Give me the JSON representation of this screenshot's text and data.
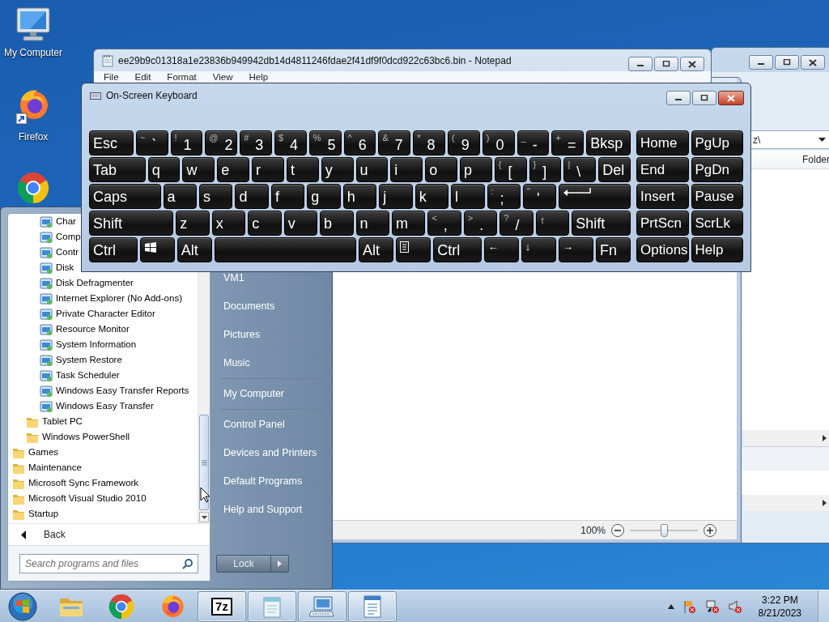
{
  "desktop_icons": [
    {
      "kind": "computer",
      "label": "My Computer"
    },
    {
      "kind": "firefox",
      "label": "Firefox"
    },
    {
      "kind": "chrome"
    }
  ],
  "explorer_window": {
    "address": "z\\",
    "column_header": "Folder"
  },
  "document_window": {
    "zoom": "100%",
    "zoom_slider": {
      "level": 0.5
    }
  },
  "notepad_window": {
    "title": "ee29b9c01318a1e23836b949942db14d4811246fdae2f41df9f0dcd922c63bc6.bin - Notepad",
    "menu": [
      "File",
      "Edit",
      "Format",
      "View",
      "Help"
    ]
  },
  "start_menu": {
    "programs": [
      {
        "kind": "group",
        "children": [
          {
            "kind": "group",
            "children": [
              {
                "kind": "program",
                "label": "Char"
              },
              {
                "kind": "program",
                "label": "Comp"
              },
              {
                "kind": "program",
                "label": "Contr"
              },
              {
                "kind": "program",
                "label": "Disk"
              },
              {
                "kind": "program",
                "label": "Disk Defragmenter"
              },
              {
                "kind": "program",
                "label": "Internet Explorer (No Add-ons)"
              },
              {
                "kind": "program",
                "label": "Private Character Editor"
              },
              {
                "kind": "program",
                "label": "Resource Monitor"
              },
              {
                "kind": "program",
                "label": "System Information"
              },
              {
                "kind": "program",
                "label": "System Restore"
              },
              {
                "kind": "program",
                "label": "Task Scheduler"
              },
              {
                "kind": "program",
                "label": "Windows Easy Transfer Reports"
              },
              {
                "kind": "program",
                "label": "Windows Easy Transfer"
              }
            ]
          },
          {
            "kind": "folder",
            "label": "Tablet PC"
          },
          {
            "kind": "folder",
            "label": "Windows PowerShell"
          }
        ]
      },
      {
        "kind": "folder",
        "label": "Games"
      },
      {
        "kind": "folder",
        "label": "Maintenance"
      },
      {
        "kind": "folder",
        "label": "Microsoft Sync Framework"
      },
      {
        "kind": "folder",
        "label": "Microsoft Visual Studio 2010"
      },
      {
        "kind": "folder",
        "label": "Startup"
      }
    ],
    "back": "Back",
    "search": {
      "placeholder": "Search programs and files"
    },
    "places": [
      [
        "VM1",
        "Documents",
        "Pictures",
        "Music"
      ],
      [
        "My Computer"
      ],
      [
        "Control Panel",
        "Devices and Printers",
        "Default Programs",
        "Help and Support"
      ]
    ],
    "lock": "Lock"
  },
  "keyboard_window": {
    "title": "On-Screen Keyboard",
    "main_rows": [
      [
        {
          "kind": "char",
          "label": "Esc"
        },
        {
          "kind": "char",
          "label": "`",
          "shift": "~"
        },
        {
          "kind": "char",
          "label": "1",
          "shift": "!"
        },
        {
          "kind": "char",
          "label": "2",
          "shift": "@"
        },
        {
          "kind": "char",
          "label": "3",
          "shift": "#"
        },
        {
          "kind": "char",
          "label": "4",
          "shift": "$"
        },
        {
          "kind": "char",
          "label": "5",
          "shift": "%"
        },
        {
          "kind": "char",
          "label": "6",
          "shift": "^"
        },
        {
          "kind": "char",
          "label": "7",
          "shift": "&"
        },
        {
          "kind": "char",
          "label": "8",
          "shift": "*"
        },
        {
          "kind": "char",
          "label": "9",
          "shift": "("
        },
        {
          "kind": "char",
          "label": "0",
          "shift": ")"
        },
        {
          "kind": "char",
          "label": "-",
          "shift": "_"
        },
        {
          "kind": "char",
          "label": "=",
          "shift": "+"
        },
        {
          "kind": "char",
          "label": "Bksp"
        }
      ],
      [
        {
          "kind": "char",
          "label": "Tab"
        },
        {
          "kind": "char",
          "label": "q"
        },
        {
          "kind": "char",
          "label": "w"
        },
        {
          "kind": "char",
          "label": "e"
        },
        {
          "kind": "char",
          "label": "r"
        },
        {
          "kind": "char",
          "label": "t"
        },
        {
          "kind": "char",
          "label": "y"
        },
        {
          "kind": "char",
          "label": "u"
        },
        {
          "kind": "char",
          "label": "i"
        },
        {
          "kind": "char",
          "label": "o"
        },
        {
          "kind": "char",
          "label": "p"
        },
        {
          "kind": "char",
          "label": "[",
          "shift": "{"
        },
        {
          "kind": "char",
          "label": "]",
          "shift": "}"
        },
        {
          "kind": "char",
          "label": "\\",
          "shift": "|"
        },
        {
          "kind": "char",
          "label": "Del"
        }
      ],
      [
        {
          "kind": "char",
          "label": "Caps"
        },
        {
          "kind": "char",
          "label": "a"
        },
        {
          "kind": "char",
          "label": "s"
        },
        {
          "kind": "char",
          "label": "d"
        },
        {
          "kind": "char",
          "label": "f"
        },
        {
          "kind": "char",
          "label": "g"
        },
        {
          "kind": "char",
          "label": "h"
        },
        {
          "kind": "char",
          "label": "j"
        },
        {
          "kind": "char",
          "label": "k"
        },
        {
          "kind": "char",
          "label": "l"
        },
        {
          "kind": "char",
          "label": ";",
          "shift": ":"
        },
        {
          "kind": "char",
          "label": "'",
          "shift": "\""
        },
        {
          "kind": "enter"
        }
      ],
      [
        {
          "kind": "char",
          "label": "Shift"
        },
        {
          "kind": "char",
          "label": "z"
        },
        {
          "kind": "char",
          "label": "x"
        },
        {
          "kind": "char",
          "label": "c"
        },
        {
          "kind": "char",
          "label": "v"
        },
        {
          "kind": "char",
          "label": "b"
        },
        {
          "kind": "char",
          "label": "n"
        },
        {
          "kind": "char",
          "label": "m"
        },
        {
          "kind": "char",
          "label": ",",
          "shift": "<"
        },
        {
          "kind": "char",
          "label": ".",
          "shift": ">"
        },
        {
          "kind": "char",
          "label": "/",
          "shift": "?"
        },
        {
          "kind": "arrow",
          "label": "↑"
        },
        {
          "kind": "char",
          "label": "Shift"
        }
      ],
      [
        {
          "kind": "char",
          "label": "Ctrl"
        },
        {
          "kind": "windows"
        },
        {
          "kind": "char",
          "label": "Alt"
        },
        {
          "kind": "space"
        },
        {
          "kind": "char",
          "label": "Alt"
        },
        {
          "kind": "menu"
        },
        {
          "kind": "char",
          "label": "Ctrl"
        },
        {
          "kind": "arrow",
          "label": "←"
        },
        {
          "kind": "arrow",
          "label": "↓"
        },
        {
          "kind": "arrow",
          "label": "→"
        },
        {
          "kind": "char",
          "label": "Fn"
        }
      ]
    ],
    "nav_rows": [
      [
        "Home",
        "PgUp"
      ],
      [
        "End",
        "PgDn"
      ],
      [
        "Insert",
        "Pause"
      ],
      [
        "PrtScn",
        "ScrLk"
      ],
      [
        "Options",
        "Help"
      ]
    ]
  },
  "taskbar": {
    "items": [
      {
        "kind": "explorer",
        "running": false
      },
      {
        "kind": "chrome",
        "running": false
      },
      {
        "kind": "firefox",
        "running": false
      },
      {
        "kind": "archiver",
        "text": "7z",
        "running": true
      },
      {
        "kind": "notepad",
        "running": true
      },
      {
        "kind": "keyboard",
        "running": true
      },
      {
        "kind": "wordpad",
        "running": true
      }
    ],
    "clock": "3:22 PM",
    "date": "8/21/2023"
  }
}
